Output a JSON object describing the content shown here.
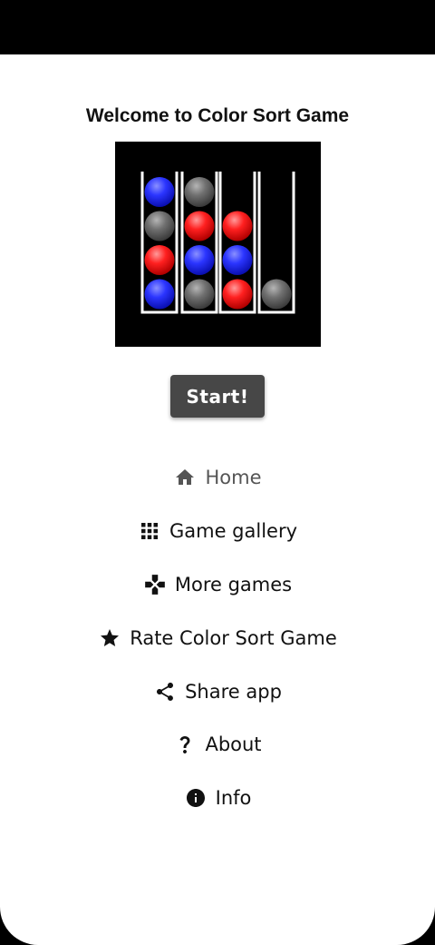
{
  "colors": {
    "tube_outline": "#ffffff",
    "ball_blue": "#1f2bff",
    "ball_red": "#ff1a1a",
    "ball_gray": "#6f6f6f",
    "button_bg": "#474747",
    "active_menu_text": "#555555"
  },
  "header": {
    "title": "Welcome to Color Sort Game"
  },
  "preview": {
    "tubes": [
      [
        "blue",
        "red",
        "gray",
        "blue"
      ],
      [
        "gray",
        "blue",
        "red",
        "gray"
      ],
      [
        "red",
        "blue",
        "red"
      ],
      [
        "gray"
      ]
    ]
  },
  "start_button": {
    "label": "Start!"
  },
  "menu": {
    "items": [
      {
        "label": "Home",
        "icon": "home-icon",
        "active": true
      },
      {
        "label": "Game gallery",
        "icon": "grid-icon"
      },
      {
        "label": "More games",
        "icon": "gamepad-icon"
      },
      {
        "label": "Rate Color Sort Game",
        "icon": "star-icon"
      },
      {
        "label": "Share app",
        "icon": "share-icon"
      },
      {
        "label": "About",
        "icon": "help-icon"
      },
      {
        "label": "Info",
        "icon": "info-icon"
      }
    ]
  }
}
